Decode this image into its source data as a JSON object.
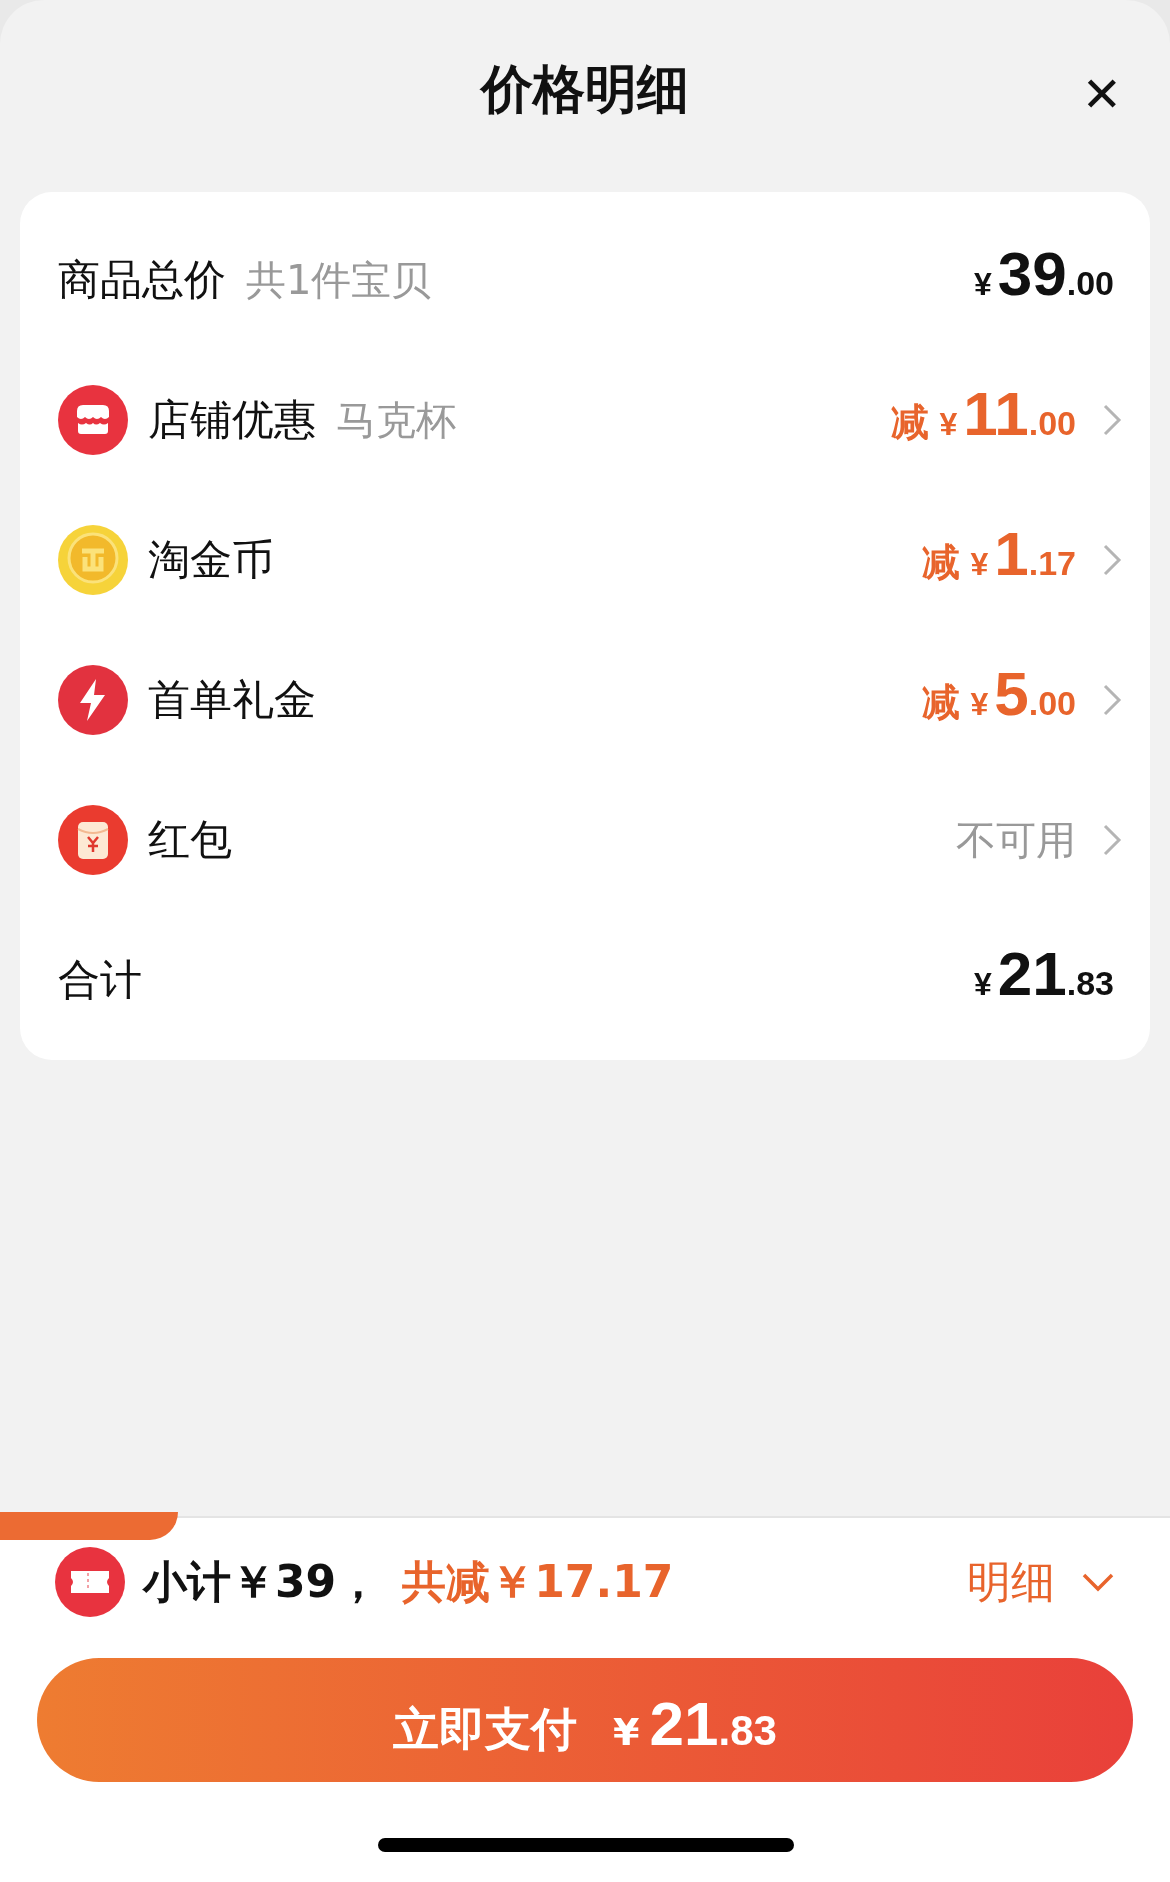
{
  "header": {
    "title": "价格明细",
    "close": "✕"
  },
  "rows": [
    {
      "kind": "total",
      "label": "商品总价",
      "note": "共1件宝贝",
      "price": {
        "currency": "¥",
        "integer": "39",
        "decimal": ".00"
      }
    },
    {
      "kind": "discount",
      "label": "店铺优惠",
      "note": "马克杯",
      "price": {
        "prefix": "减",
        "currency": "¥",
        "integer": "11",
        "decimal": ".00"
      }
    },
    {
      "kind": "discount",
      "label": "淘金币",
      "price": {
        "prefix": "减",
        "currency": "¥",
        "integer": "1",
        "decimal": ".17"
      }
    },
    {
      "kind": "discount",
      "label": "首单礼金",
      "price": {
        "prefix": "减",
        "currency": "¥",
        "integer": "5",
        "decimal": ".00"
      }
    },
    {
      "kind": "unavailable",
      "label": "红包",
      "status": "不可用"
    },
    {
      "kind": "sum",
      "label": "合计",
      "price": {
        "currency": "¥",
        "integer": "21",
        "decimal": ".83"
      }
    }
  ],
  "footer": {
    "subtotal": "小计￥39，",
    "discount": "共减￥17.17",
    "details": "明细",
    "pay_button": {
      "label": "立即支付",
      "currency": "¥",
      "integer": "21",
      "decimal": ".83"
    }
  }
}
